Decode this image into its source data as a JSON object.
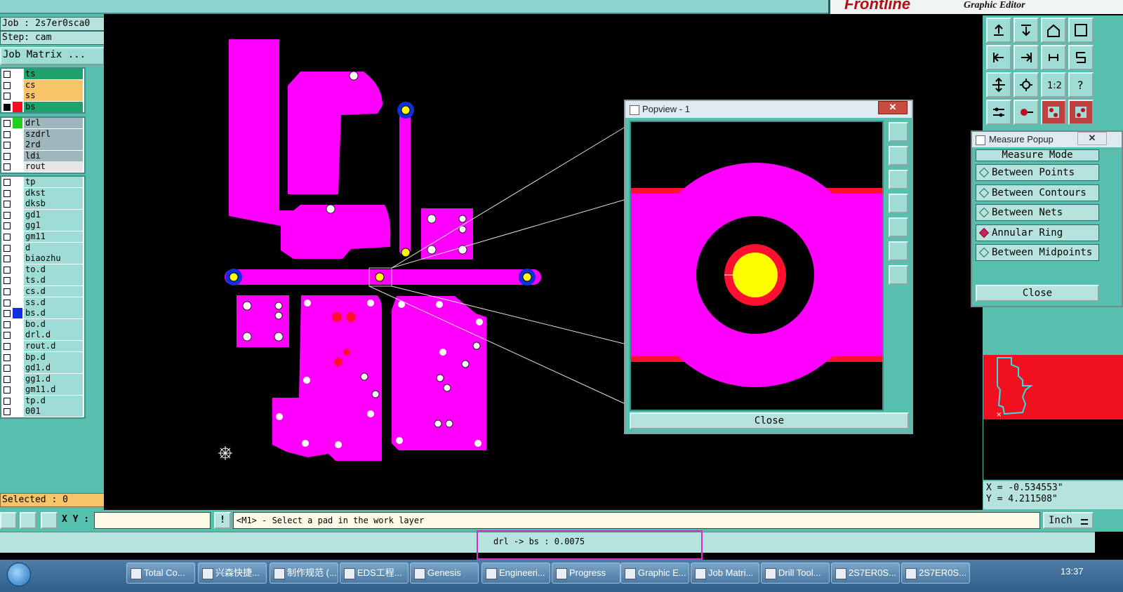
{
  "brand": {
    "logo_text": "Frontline",
    "subtitle": "Graphic Editor"
  },
  "left": {
    "job_label": "Job : 2s7er0sca0",
    "step_label": "Step: cam",
    "job_matrix_btn": "Job Matrix ...",
    "selected_label": "Selected : 0",
    "groups": [
      [
        {
          "name": "ts",
          "color": "#1fa26b",
          "checked": false,
          "swatch": ""
        },
        {
          "name": "cs",
          "color": "#f7c46a",
          "checked": false,
          "swatch": ""
        },
        {
          "name": "ss",
          "color": "#f7c46a",
          "checked": false,
          "swatch": ""
        },
        {
          "name": "bs",
          "color": "#1fa26b",
          "checked": true,
          "swatch": "#f01020"
        }
      ],
      [
        {
          "name": "drl",
          "color": "#9eb7bc",
          "checked": false,
          "swatch": "#20d020"
        },
        {
          "name": "szdrl",
          "color": "#9eb7bc",
          "checked": false,
          "swatch": ""
        },
        {
          "name": "2rd",
          "color": "#9eb7bc",
          "checked": false,
          "swatch": ""
        },
        {
          "name": "ldi",
          "color": "#9eb7bc",
          "checked": false,
          "swatch": ""
        },
        {
          "name": "rout",
          "color": "#e6e6e6",
          "checked": false,
          "swatch": ""
        }
      ],
      [
        {
          "name": "tp",
          "color": "#9fdcd6",
          "checked": false,
          "swatch": ""
        },
        {
          "name": "dkst",
          "color": "#9fdcd6",
          "checked": false,
          "swatch": ""
        },
        {
          "name": "dksb",
          "color": "#9fdcd6",
          "checked": false,
          "swatch": ""
        },
        {
          "name": "gd1",
          "color": "#9fdcd6",
          "checked": false,
          "swatch": ""
        },
        {
          "name": "gg1",
          "color": "#9fdcd6",
          "checked": false,
          "swatch": ""
        },
        {
          "name": "gm11",
          "color": "#9fdcd6",
          "checked": false,
          "swatch": ""
        },
        {
          "name": "d",
          "color": "#9fdcd6",
          "checked": false,
          "swatch": ""
        },
        {
          "name": "biaozhu",
          "color": "#9fdcd6",
          "checked": false,
          "swatch": ""
        },
        {
          "name": "to.d",
          "color": "#9fdcd6",
          "checked": false,
          "swatch": ""
        },
        {
          "name": "ts.d",
          "color": "#9fdcd6",
          "checked": false,
          "swatch": ""
        },
        {
          "name": "cs.d",
          "color": "#9fdcd6",
          "checked": false,
          "swatch": ""
        },
        {
          "name": "ss.d",
          "color": "#9fdcd6",
          "checked": false,
          "swatch": ""
        },
        {
          "name": "bs.d",
          "color": "#9fdcd6",
          "checked": false,
          "swatch": "#1030e0"
        },
        {
          "name": "bo.d",
          "color": "#9fdcd6",
          "checked": false,
          "swatch": ""
        },
        {
          "name": "drl.d",
          "color": "#9fdcd6",
          "checked": false,
          "swatch": ""
        },
        {
          "name": "rout.d",
          "color": "#9fdcd6",
          "checked": false,
          "swatch": ""
        },
        {
          "name": "bp.d",
          "color": "#9fdcd6",
          "checked": false,
          "swatch": ""
        },
        {
          "name": "gd1.d",
          "color": "#9fdcd6",
          "checked": false,
          "swatch": ""
        },
        {
          "name": "gg1.d",
          "color": "#9fdcd6",
          "checked": false,
          "swatch": ""
        },
        {
          "name": "gm11.d",
          "color": "#9fdcd6",
          "checked": false,
          "swatch": ""
        },
        {
          "name": "tp.d",
          "color": "#9fdcd6",
          "checked": false,
          "swatch": ""
        },
        {
          "name": "001",
          "color": "#9fdcd6",
          "checked": false,
          "swatch": ""
        }
      ]
    ]
  },
  "popview": {
    "title": "Popview - 1",
    "close_x": "✕",
    "close_label": "Close"
  },
  "measure": {
    "title": "Measure Popup",
    "close_x": "✕",
    "mode_header": "Measure Mode",
    "options": [
      {
        "label": "Between Points",
        "selected": false
      },
      {
        "label": "Between Contours",
        "selected": false
      },
      {
        "label": "Between Nets",
        "selected": false
      },
      {
        "label": "Annular Ring",
        "selected": true
      },
      {
        "label": "Between Midpoints",
        "selected": false
      }
    ],
    "close_label": "Close"
  },
  "coords": {
    "x": "X = -0.534553\"",
    "y": "Y = 4.211508\""
  },
  "command": {
    "xy_label": "X Y :",
    "xy_value": "",
    "excl": "!",
    "prompt": "<M1> - Select a pad in the work layer",
    "unit": "Inch"
  },
  "status": {
    "message": "drl -> bs : 0.0075"
  },
  "taskbar": {
    "items": [
      "Total Co...",
      "兴森快捷...",
      "制作规范 (...",
      "EDS工程...",
      "Genesis",
      "Engineeri...",
      "Progress",
      "Graphic E...",
      "Job Matri...",
      "Drill Tool...",
      "2S7ER0S...",
      "2S7ER0S..."
    ],
    "clock": "13:37"
  }
}
